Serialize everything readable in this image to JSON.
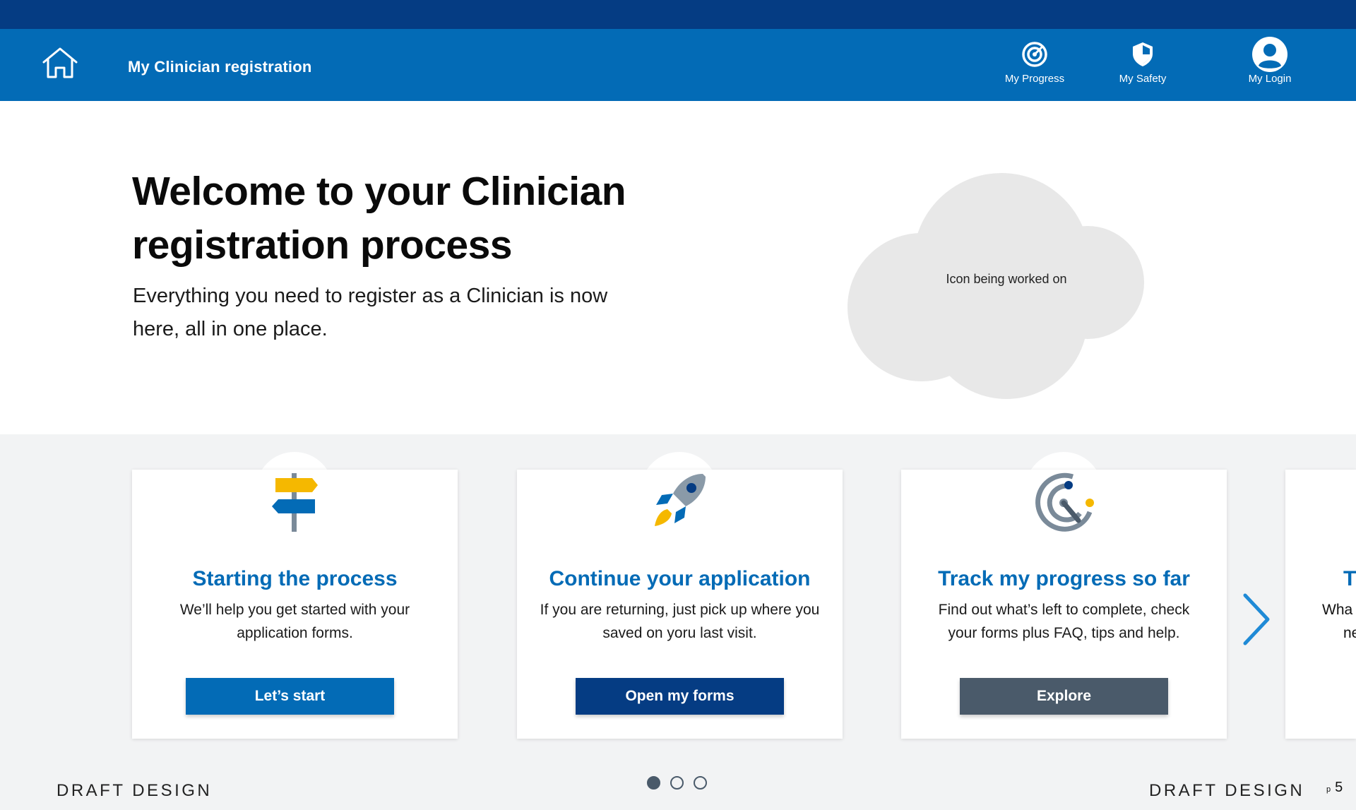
{
  "header": {
    "app_title": "My Clinician registration",
    "nav": [
      {
        "label": "My Progress",
        "icon": "target-icon"
      },
      {
        "label": "My Safety",
        "icon": "shield-icon"
      },
      {
        "label": "My Login",
        "icon": "user-icon"
      }
    ]
  },
  "hero": {
    "title": "Welcome to your Clinician registration process",
    "subtitle": "Everything you need to register as a Clinician is now here, all in one place.",
    "icon_placeholder": "Icon being worked on"
  },
  "cards": [
    {
      "title": "Starting the process",
      "description": "We’ll help you get started with your application forms.",
      "button": "Let’s start",
      "icon": "signpost-icon",
      "button_color": "#036bb6"
    },
    {
      "title": "Continue your application",
      "description": "If you are returning, just pick up where you saved on yoru last visit.",
      "button": "Open my forms",
      "icon": "rocket-icon",
      "button_color": "#053c83"
    },
    {
      "title": "Track my progress so far",
      "description": "Find out what’s left to complete, check your forms plus FAQ, tips and help.",
      "button": "Explore",
      "icon": "radar-icon",
      "button_color": "#4a5a6a"
    }
  ],
  "partial_card": {
    "title_fragment": "T",
    "line1_fragment": "Wha",
    "line2_fragment": "ne"
  },
  "carousel": {
    "pages": 3,
    "active": 1
  },
  "footer": {
    "left_label": "DRAFT DESIGN",
    "right_label": "DRAFT DESIGN",
    "page_prefix": "p",
    "page_number": "5"
  },
  "colors": {
    "top_strip": "#053c83",
    "nav_bar": "#036bb6",
    "accent_yellow": "#f5b800",
    "background": "#f2f3f4"
  }
}
